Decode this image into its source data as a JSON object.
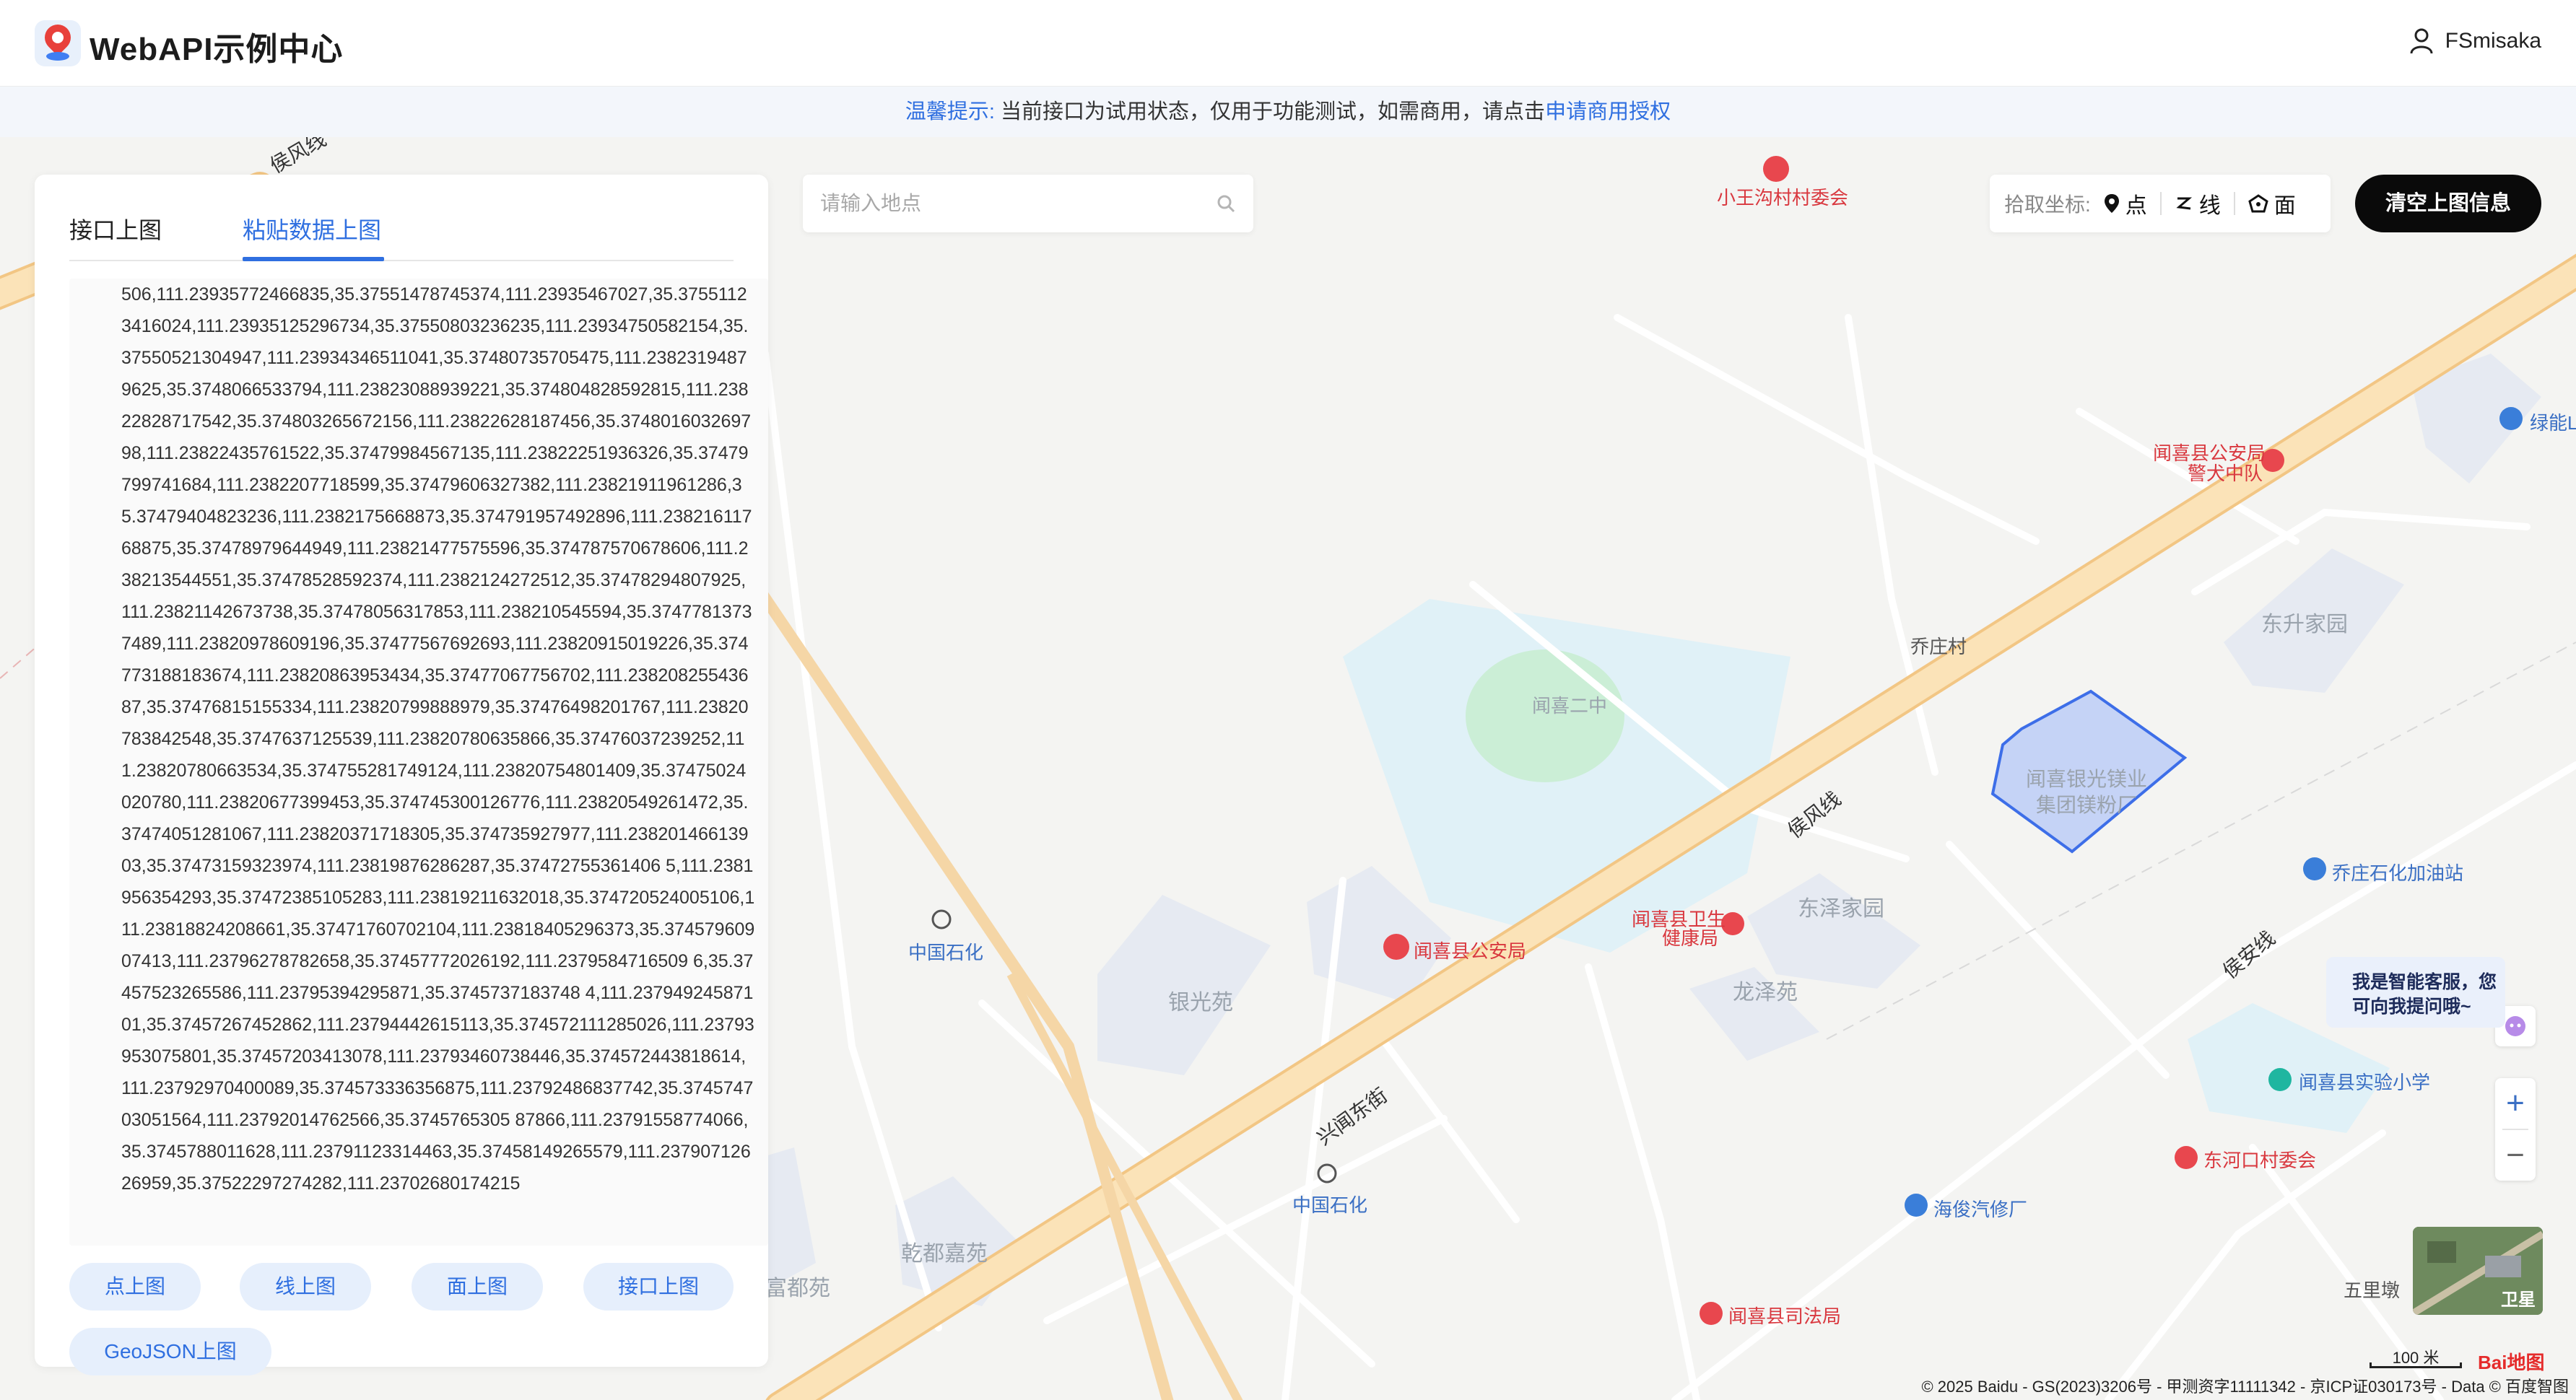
{
  "header": {
    "brand": "WebAPI示例中心",
    "username": "FSmisaka"
  },
  "notice": {
    "prefix": "温馨提示:",
    "text": "当前接口为试用状态，仅用于功能测试，如需商用，请点击",
    "link": "申请商用授权"
  },
  "panel": {
    "tabs": [
      {
        "label": "接口上图",
        "active": false
      },
      {
        "label": "粘贴数据上图",
        "active": true
      }
    ],
    "textarea_value": "506,111.23935772466835,35.37551478745374,111.23935467027,35.37551123416024,111.23935125296734,35.37550803236235,111.23934750582154,35.37550521304947,111.23934346511041,35.37480735705475,111.23823194879625,35.3748066533794,111.23823088939221,35.374804828592815,111.23822828717542,35.374803265672156,111.23822628187456,35.374801603269798,111.23822435761522,35.37479984567135,111.23822251936326,35.37479799741684,111.2382207718599,35.37479606327382,111.23821911961286,35.37479404823236,111.2382175668873,35.374791957492896,111.23821611768875,35.37478979644949,111.23821477575596,35.374787570678606,111.238213544551,35.37478528592374,111.2382124272512,35.37478294807925,111.23821142673738,35.37478056317853,111.238210545594,35.37477813737489,111.23820978609196,35.37477567692693,111.23820915019226,35.374773188183674,111.23820863953434,35.37477067756702,111.23820825543687,35.37476815155334,111.23820799888979,35.37476498201767,111.23820783842548,35.3747637125539,111.23820780635866,35.37476037239252,111.23820780663534,35.374755281749124,111.23820754801409,35.37475024020780,111.23820677399453,35.374745300126776,111.23820549261472,35.37474051281067,111.23820371718305,35.374735927977,111.23820146613903,35.37473159323974,111.23819876286287,35.37472755361406 5,111.2381956354293,35.37472385105283,111.23819211632018,35.374720524005106,111.23818824208661,35.37471760702104,111.23818405296373,35.37457960907413,111.23796278782658,35.37457772026192,111.2379584716509 6,35.37457523265586,111.23795394295871,35.3745737183748 4,111.23794924587101,35.37457267452862,111.23794442615113,35.374572111285026,111.23793953075801,35.37457203413078,111.23793460738446,35.374572443818614,111.23792970400089,35.374573336356875,111.23792486837742,35.374574703051564,111.23792014762566,35.3745765305 87866,111.23791558774066,35.3745788011628,111.23791123314463,35.37458149265579,111.23790712626959,35.37522297274282,111.23702680174215",
    "buttons": [
      "点上图",
      "线上图",
      "面上图",
      "接口上图",
      "GeoJSON上图"
    ]
  },
  "search": {
    "placeholder": "请输入地点"
  },
  "coord_picker": {
    "label": "拾取坐标:",
    "options": [
      "点",
      "线",
      "面"
    ]
  },
  "clear_button": "清空上图信息",
  "map": {
    "roads": [
      "侯风线",
      "侯风线",
      "兴闻东街",
      "侯安线"
    ],
    "pois": [
      {
        "name": "小王沟村村委会",
        "kind": "red"
      },
      {
        "name": "绿能LN",
        "kind": "blue"
      },
      {
        "name": "闻喜县公安局",
        "kind": "red"
      },
      {
        "name": "警犬中队",
        "kind": "red"
      },
      {
        "name": "乔庄村",
        "kind": "plain"
      },
      {
        "name": "东升家园",
        "kind": "grey"
      },
      {
        "name": "闻喜二中",
        "kind": "grey"
      },
      {
        "name": "闻喜银光镁业",
        "kind": "grey"
      },
      {
        "name": "集团镁粉厂",
        "kind": "grey"
      },
      {
        "name": "乔庄石化加油站",
        "kind": "blue"
      },
      {
        "name": "闻喜县卫生",
        "kind": "red"
      },
      {
        "name": "健康局",
        "kind": "red"
      },
      {
        "name": "东泽家园",
        "kind": "grey"
      },
      {
        "name": "龙泽苑",
        "kind": "grey"
      },
      {
        "name": "闻喜县公安局",
        "kind": "red"
      },
      {
        "name": "银光苑",
        "kind": "grey"
      },
      {
        "name": "中国石化",
        "kind": "blue"
      },
      {
        "name": "中国石化",
        "kind": "blue"
      },
      {
        "name": "乾都嘉苑",
        "kind": "grey"
      },
      {
        "name": "富都苑",
        "kind": "grey"
      },
      {
        "name": "闻喜县实验小学",
        "kind": "blue"
      },
      {
        "name": "东河口村委会",
        "kind": "red"
      },
      {
        "name": "海俊汽修厂",
        "kind": "blue"
      },
      {
        "name": "闻喜县司法局",
        "kind": "red"
      },
      {
        "name": "五里墩",
        "kind": "plain"
      }
    ]
  },
  "ai_chat": {
    "line1": "我是智能客服，您",
    "line2": "可向我提问哦~"
  },
  "zoom": {
    "in": "+",
    "out": "−"
  },
  "satellite_label": "卫星",
  "scale_label": "100 米",
  "baidu_logo": "Bai地图",
  "copyright": "© 2025 Baidu - GS(2023)3206号 - 甲测资字11111342 - 京ICP证030173号 - Data © 百度智图",
  "colors": {
    "accent": "#2f6fe0",
    "highway": "#f9d99a",
    "polygon": "#3d6ee8"
  }
}
